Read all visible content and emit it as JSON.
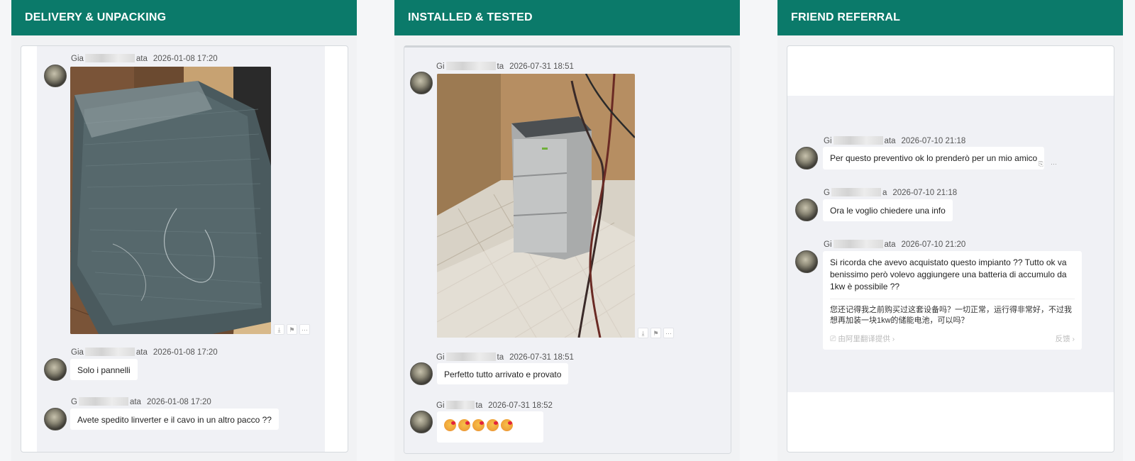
{
  "panels": [
    {
      "title": "DELIVERY & UNPACKING",
      "messages": [
        {
          "name": "Gia",
          "name_end": "ata",
          "time": "2026-01-08 17:20",
          "photo": "plastic-wrapped-solar-panel"
        },
        {
          "name": "Gia",
          "name_end": "ata",
          "time": "2026-01-08 17:20",
          "text": "Solo i pannelli"
        },
        {
          "name": "G",
          "name_end": "ata",
          "time": "2026-01-08 17:20",
          "text": "Avete spedito linverter e il cavo in un altro pacco ??"
        }
      ]
    },
    {
      "title": "INSTALLED & TESTED",
      "messages": [
        {
          "name": "Gi",
          "name_end": "ta",
          "time": "2026-07-31 18:51",
          "photo": "battery-storage-unit"
        },
        {
          "name": "Gi",
          "name_end": "ta",
          "time": "2026-07-31 18:51",
          "text": "Perfetto tutto arrivato e provato"
        },
        {
          "name": "Gi",
          "name_end": "ta",
          "time": "2026-07-31 18:52",
          "emoji_count": 5
        }
      ]
    },
    {
      "title": "FRIEND REFERRAL",
      "messages": [
        {
          "name": "Gi",
          "name_end": "ata",
          "time": "2026-07-10 21:18",
          "text": "Per questo preventivo ok lo prenderò per un mio amico"
        },
        {
          "name": "G",
          "name_end": "a",
          "time": "2026-07-10 21:18",
          "text": "Ora le voglio chiedere una info"
        },
        {
          "name": "Gi",
          "name_end": "ata",
          "time": "2026-07-10 21:20",
          "text": "Si ricorda che avevo acquistato questo impianto ?? Tutto ok va benissimo però volevo aggiungere una batteria di accumulo da 1kw è possibile ??",
          "translation": "您还记得我之前购买过这套设备吗？一切正常，运行得非常好，不过我想再加装一块1kw的储能电池，可以吗？",
          "translation_source": "由阿里翻译提供 ›",
          "feedback": "反馈 ›"
        }
      ]
    }
  ],
  "colors": {
    "header": "#0b7a6a",
    "chat_bg": "#f0f1f5",
    "bubble": "#ffffff"
  },
  "icons": {
    "download": "download-icon",
    "flag": "flag-icon",
    "more": "more-icon",
    "reply": "reply-icon",
    "translate": "translate-icon"
  }
}
